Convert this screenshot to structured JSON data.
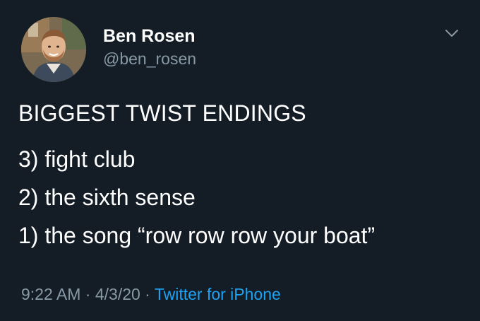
{
  "tweet": {
    "author": {
      "display_name": "Ben Rosen",
      "handle": "@ben_rosen",
      "avatar_icon": "profile-photo"
    },
    "text": {
      "headline": "BIGGEST TWIST ENDINGS",
      "items": [
        "3) fight club",
        "2) the sixth sense",
        "1) the song “row row row your boat”"
      ]
    },
    "meta": {
      "time": "9:22 AM",
      "separator": " · ",
      "date": "4/3/20",
      "source": "Twitter for iPhone"
    },
    "menu_icon": "chevron-down-icon"
  },
  "colors": {
    "background": "#141d26",
    "primary_text": "#ffffff",
    "secondary_text": "#8899a6",
    "link": "#1da1f2"
  }
}
